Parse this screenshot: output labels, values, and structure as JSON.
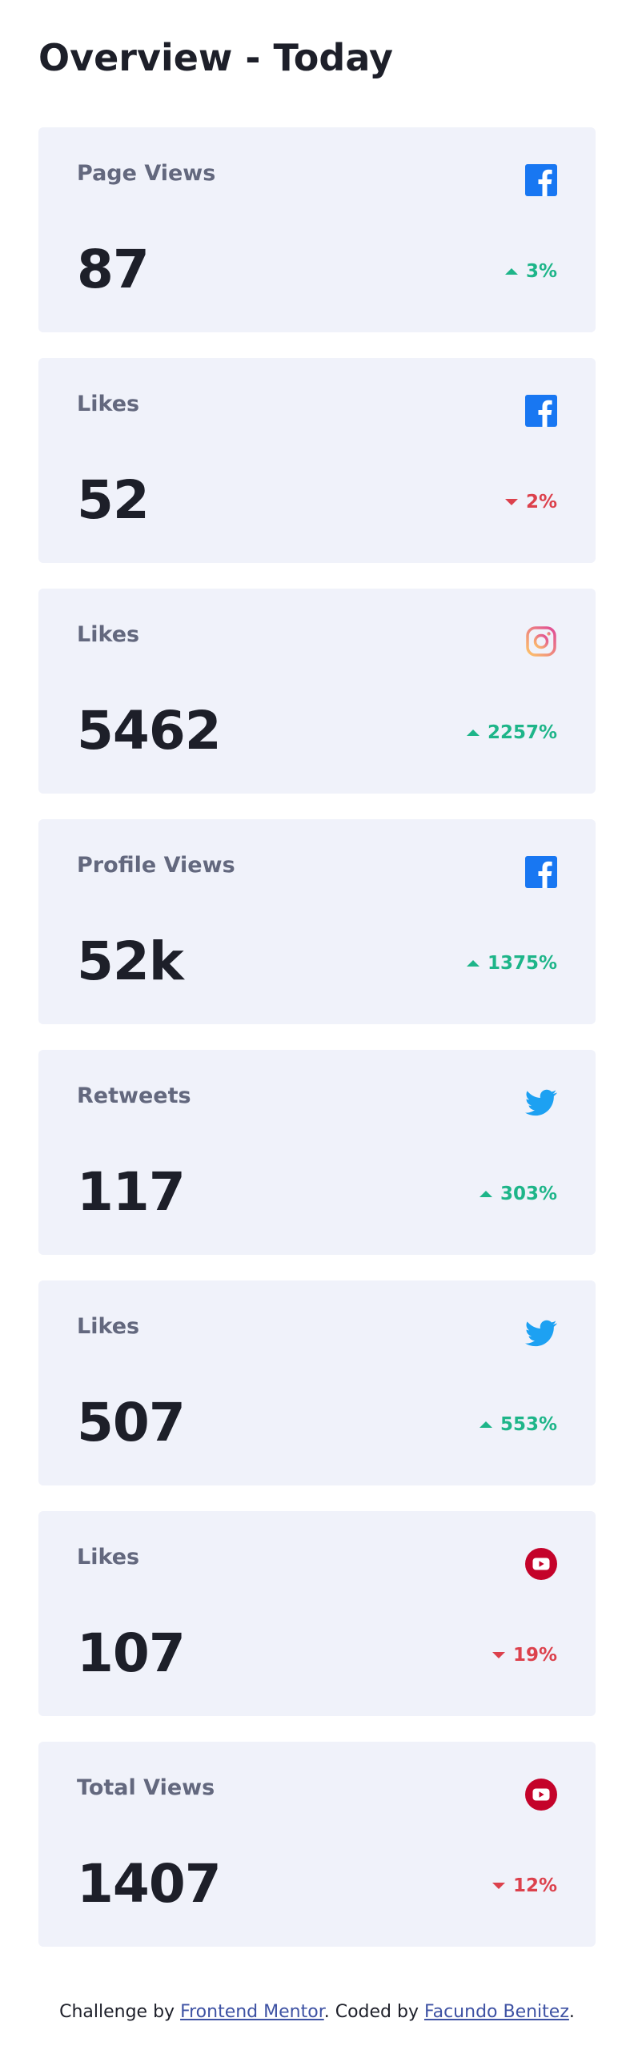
{
  "title": "Overview - Today",
  "cards": [
    {
      "label": "Page Views",
      "value": "87",
      "change": "3%",
      "trend": "up",
      "icon": "facebook-icon"
    },
    {
      "label": "Likes",
      "value": "52",
      "change": "2%",
      "trend": "down",
      "icon": "facebook-icon"
    },
    {
      "label": "Likes",
      "value": "5462",
      "change": "2257%",
      "trend": "up",
      "icon": "instagram-icon"
    },
    {
      "label": "Profile Views",
      "value": "52k",
      "change": "1375%",
      "trend": "up",
      "icon": "facebook-icon"
    },
    {
      "label": "Retweets",
      "value": "117",
      "change": "303%",
      "trend": "up",
      "icon": "twitter-icon"
    },
    {
      "label": "Likes",
      "value": "507",
      "change": "553%",
      "trend": "up",
      "icon": "twitter-icon"
    },
    {
      "label": "Likes",
      "value": "107",
      "change": "19%",
      "trend": "down",
      "icon": "youtube-icon"
    },
    {
      "label": "Total Views",
      "value": "1407",
      "change": "12%",
      "trend": "down",
      "icon": "youtube-icon"
    }
  ],
  "footer": {
    "prefix": "Challenge by ",
    "link1": "Frontend Mentor",
    "middle": ". Coded by ",
    "link2": "Facundo Benitez",
    "suffix": "."
  },
  "colors": {
    "facebook": "#1877f2",
    "twitter": "#1da1f2",
    "youtube": "#c4032a",
    "up": "#1eb589",
    "down": "#dc414c",
    "card_bg": "#f0f2fa"
  }
}
